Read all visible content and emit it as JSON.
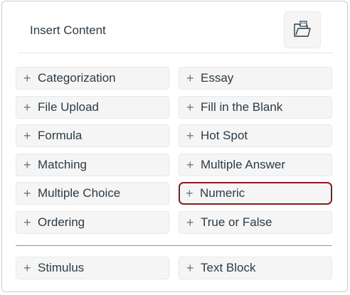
{
  "header": {
    "title": "Insert Content",
    "icon": "folder-icon"
  },
  "plus_glyph": "+",
  "content_items": [
    {
      "label": "Categorization"
    },
    {
      "label": "Essay"
    },
    {
      "label": "File Upload"
    },
    {
      "label": "Fill in the Blank"
    },
    {
      "label": "Formula"
    },
    {
      "label": "Hot Spot"
    },
    {
      "label": "Matching"
    },
    {
      "label": "Multiple Answer"
    },
    {
      "label": "Multiple Choice"
    },
    {
      "label": "Numeric",
      "selected": true
    },
    {
      "label": "Ordering"
    },
    {
      "label": "True or False"
    }
  ],
  "stimulus_items": [
    {
      "label": "Stimulus"
    },
    {
      "label": "Text Block"
    }
  ],
  "colors": {
    "selected_border": "#8b1a1a",
    "text": "#2d3b45",
    "button_bg": "#f5f5f5"
  }
}
